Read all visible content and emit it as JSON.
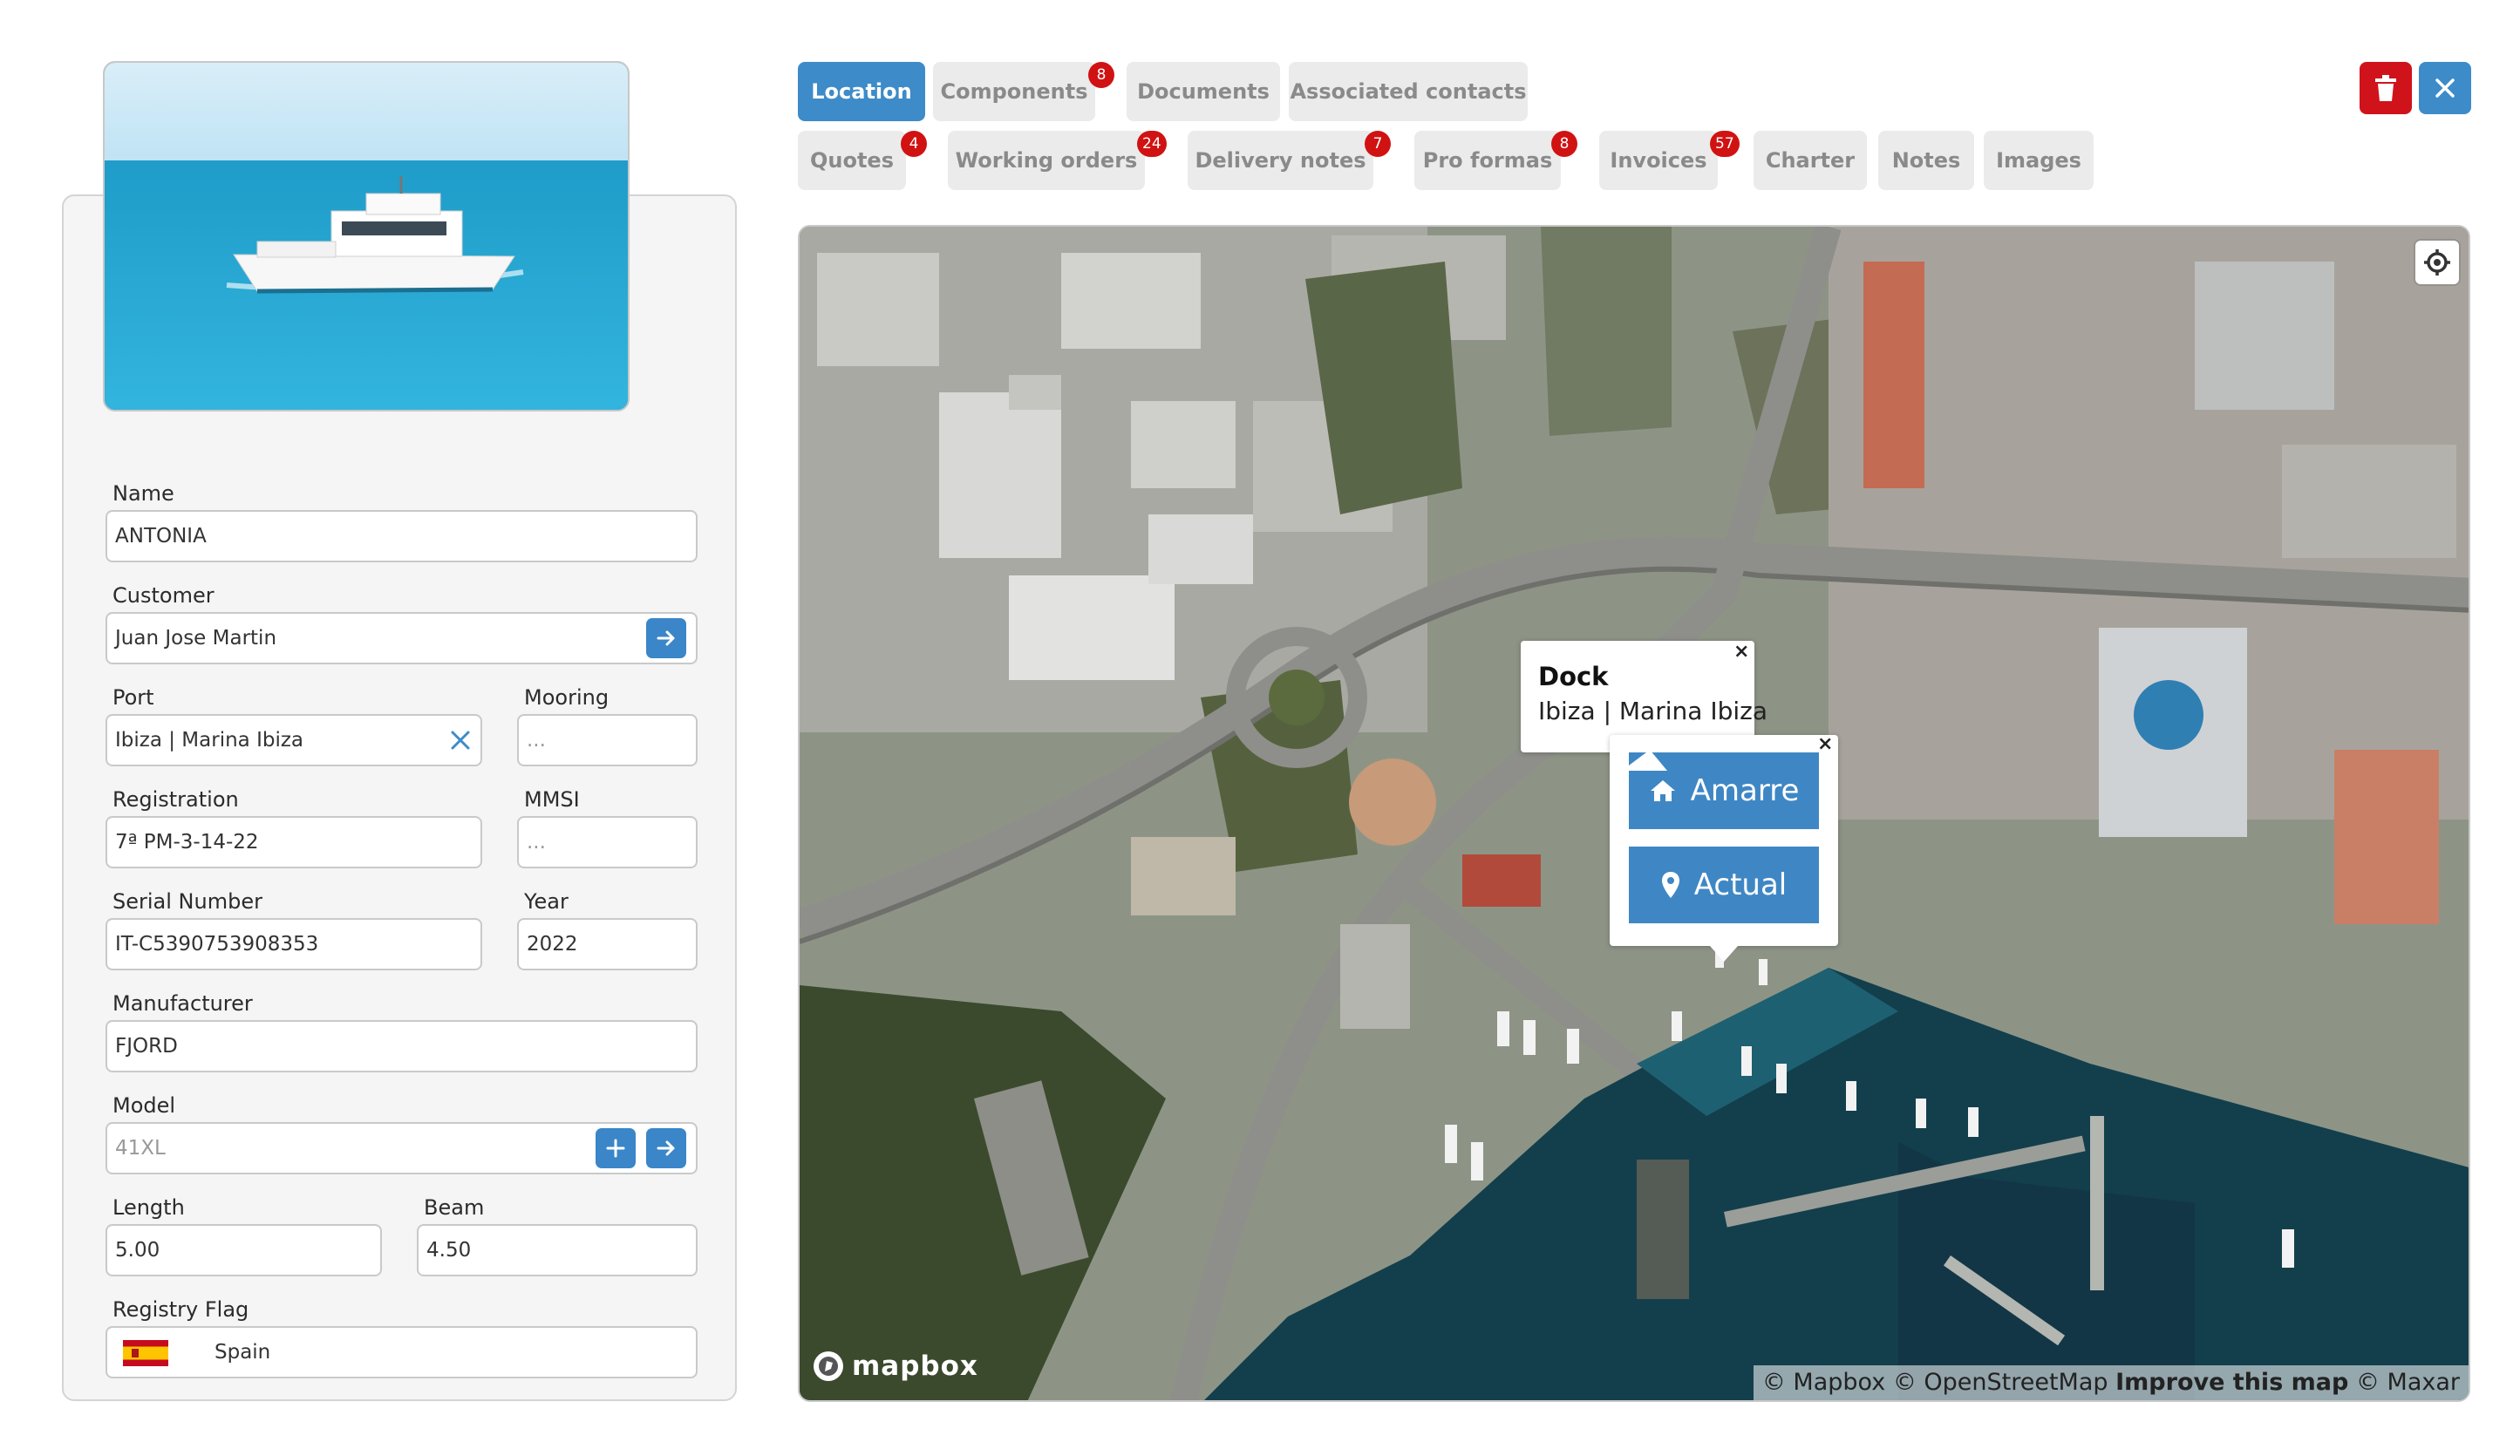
{
  "boat": {
    "name_label": "Name",
    "name_value": "ANTONIA",
    "customer_label": "Customer",
    "customer_value": "Juan Jose Martin",
    "port_label": "Port",
    "port_value": "Ibiza | Marina Ibiza",
    "mooring_label": "Mooring",
    "mooring_placeholder": "...",
    "registration_label": "Registration",
    "registration_value": "7ª PM-3-14-22",
    "mmsi_label": "MMSI",
    "mmsi_placeholder": "...",
    "serial_label": "Serial Number",
    "serial_value": "IT-C5390753908353",
    "year_label": "Year",
    "year_value": "2022",
    "manufacturer_label": "Manufacturer",
    "manufacturer_value": "FJORD",
    "model_label": "Model",
    "model_value": "41XL",
    "length_label": "Length",
    "length_value": "5.00",
    "beam_label": "Beam",
    "beam_value": "4.50",
    "flag_label": "Registry Flag",
    "flag_value": "Spain"
  },
  "tabs": {
    "row1": [
      {
        "label": "Location",
        "active": true
      },
      {
        "label": "Components",
        "badge": "8"
      },
      {
        "label": "Documents"
      },
      {
        "label": "Associated contacts"
      }
    ],
    "row2": [
      {
        "label": "Quotes",
        "badge": "4"
      },
      {
        "label": "Working orders",
        "badge": "24"
      },
      {
        "label": "Delivery notes",
        "badge": "7"
      },
      {
        "label": "Pro formas",
        "badge": "8"
      },
      {
        "label": "Invoices",
        "badge": "57"
      },
      {
        "label": "Charter"
      },
      {
        "label": "Notes"
      },
      {
        "label": "Images"
      }
    ]
  },
  "actions": {
    "delete_icon": "trash-icon",
    "close_icon": "close-icon",
    "delete_color": "#d0131b",
    "close_color": "#3d8bc9"
  },
  "map": {
    "dock_popup": {
      "title": "Dock",
      "subtitle": "Ibiza | Marina Ibiza",
      "close": "×"
    },
    "action_popup": {
      "close": "×",
      "buttons": [
        {
          "label": "Amarre",
          "icon": "home-icon"
        },
        {
          "label": "Actual",
          "icon": "map-marker-icon"
        }
      ]
    },
    "logo": "mapbox",
    "attribution": {
      "mapbox": "© Mapbox",
      "osm": "© OpenStreetMap",
      "improve": "Improve this map",
      "maxar": "© Maxar"
    },
    "locate_icon": "locate-icon"
  },
  "colors": {
    "accent": "#3d8bc9",
    "badge": "#d11212"
  }
}
